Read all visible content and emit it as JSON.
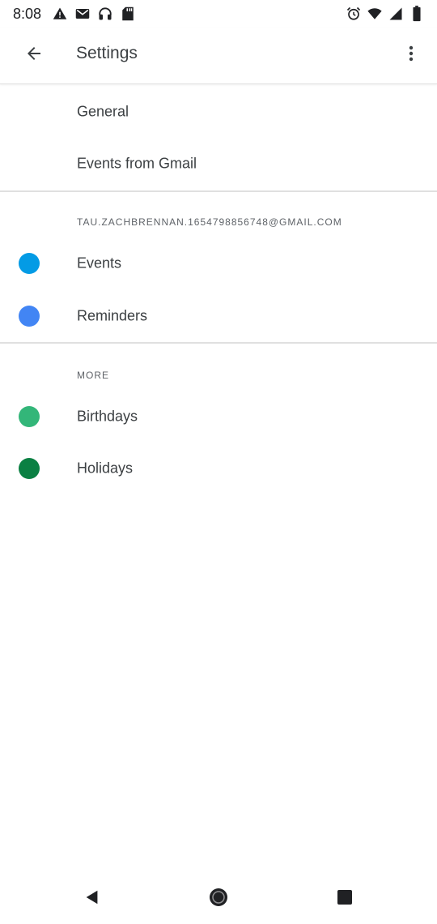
{
  "status_bar": {
    "time": "8:08",
    "left_icons": [
      "warning-icon",
      "gmail-icon",
      "headphones-icon",
      "sd-card-icon"
    ],
    "right_icons": [
      "alarm-icon",
      "wifi-icon",
      "signal-icon",
      "battery-icon"
    ]
  },
  "app_bar": {
    "title": "Settings",
    "back_icon": "back-arrow-icon",
    "overflow_icon": "more-vert-icon"
  },
  "general_section": {
    "items": [
      {
        "label": "General"
      },
      {
        "label": "Events from Gmail"
      }
    ]
  },
  "account_section": {
    "header": "TAU.ZACHBRENNAN.1654798856748@GMAIL.COM",
    "items": [
      {
        "label": "Events",
        "color": "#039be5"
      },
      {
        "label": "Reminders",
        "color": "#4285f4"
      }
    ]
  },
  "more_section": {
    "header": "MORE",
    "items": [
      {
        "label": "Birthdays",
        "color": "#33b679"
      },
      {
        "label": "Holidays",
        "color": "#0b8043"
      }
    ]
  },
  "nav_bar": {
    "icons": [
      "nav-back-icon",
      "nav-home-icon",
      "nav-recents-icon"
    ]
  }
}
